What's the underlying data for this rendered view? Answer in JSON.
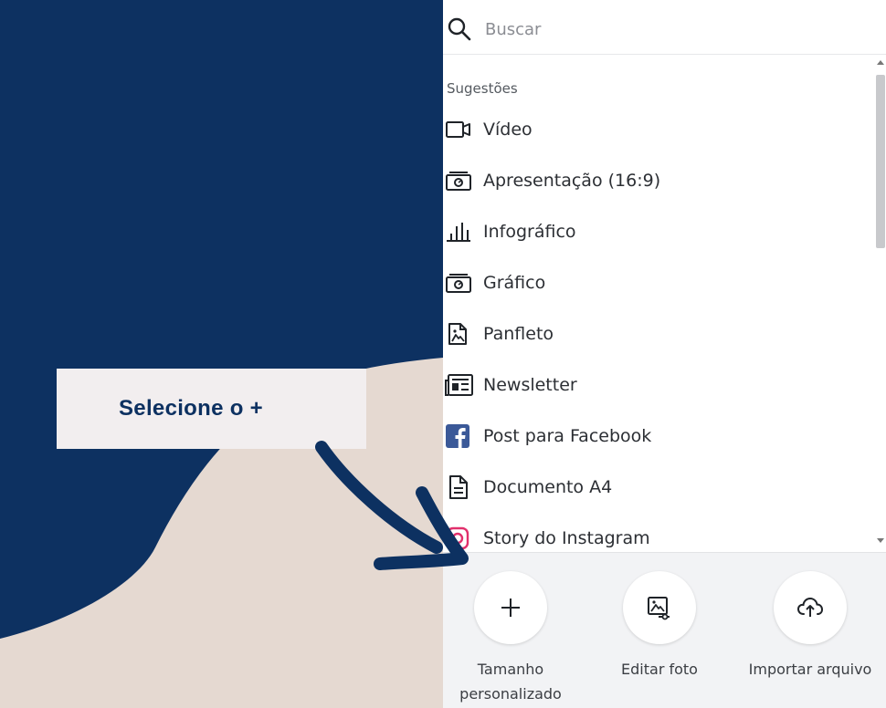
{
  "callout": {
    "text": "Selecione o +"
  },
  "search": {
    "placeholder": "Buscar"
  },
  "suggestions": {
    "title": "Sugestões",
    "items": [
      {
        "label": "Vídeo",
        "icon": "video-camera-icon"
      },
      {
        "label": "Apresentação (16:9)",
        "icon": "presentation-icon"
      },
      {
        "label": "Infográfico",
        "icon": "bar-chart-icon"
      },
      {
        "label": "Gráfico",
        "icon": "presentation-icon"
      },
      {
        "label": "Panfleto",
        "icon": "flyer-icon"
      },
      {
        "label": "Newsletter",
        "icon": "newsletter-icon"
      },
      {
        "label": "Post para Facebook",
        "icon": "facebook-icon"
      },
      {
        "label": "Documento A4",
        "icon": "document-icon"
      },
      {
        "label": "Story do Instagram",
        "icon": "instagram-icon"
      }
    ]
  },
  "actions": {
    "custom_size": "Tamanho personalizado",
    "edit_photo": "Editar foto",
    "import_file": "Importar arquivo"
  },
  "colors": {
    "navy": "#0d3161",
    "beige": "#e5d9d1",
    "facebook": "#3b5998",
    "instagram": "#e1306c"
  }
}
